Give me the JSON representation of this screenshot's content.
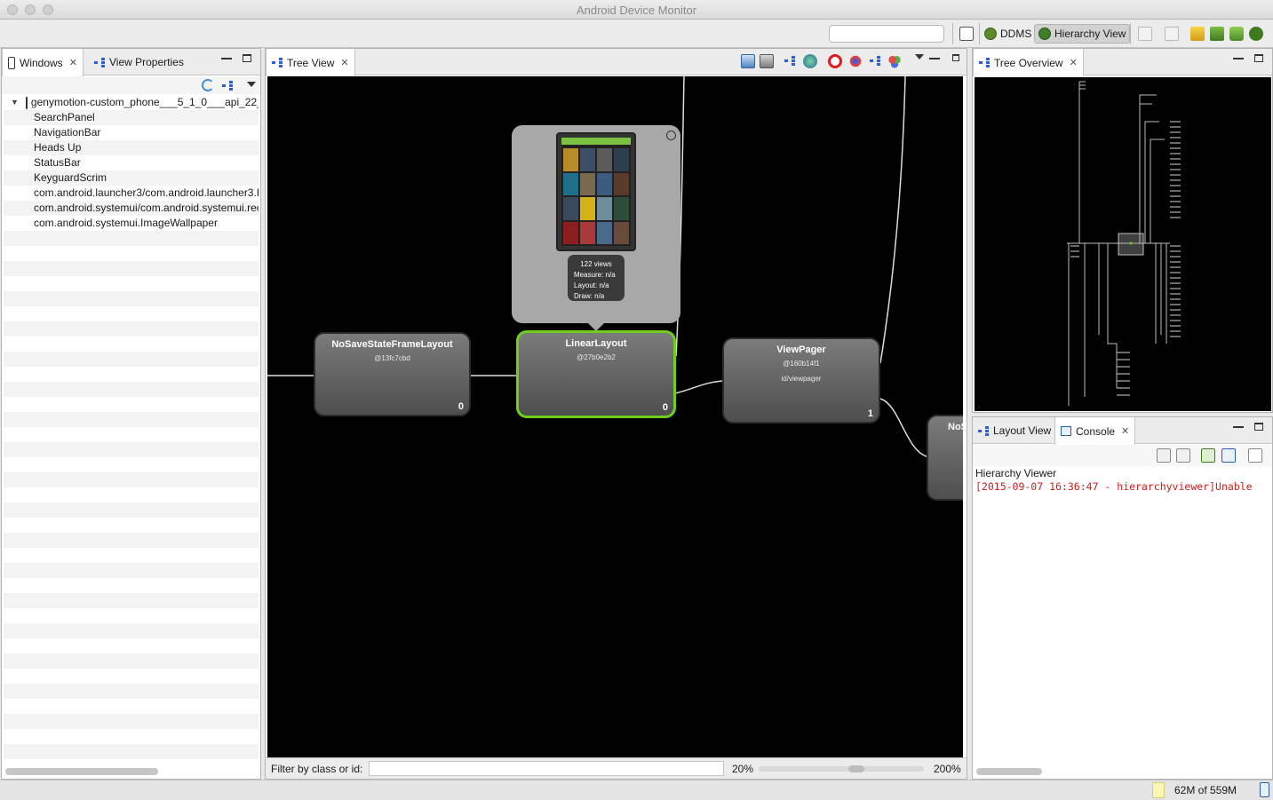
{
  "window": {
    "title": "Android Device Monitor"
  },
  "toolbar": {
    "search_placeholder": "",
    "perspectives": [
      {
        "label": "DDMS",
        "active": false
      },
      {
        "label": "Hierarchy View",
        "active": true
      }
    ]
  },
  "windows_panel": {
    "tabs": [
      {
        "label": "Windows",
        "icon": "phone-icon",
        "active": true
      },
      {
        "label": "View Properties",
        "icon": "tree-icon",
        "active": false
      }
    ],
    "device": "genymotion-custom_phone___5_1_0___api_22_",
    "items": [
      "SearchPanel",
      "NavigationBar",
      "Heads Up",
      "StatusBar",
      "KeyguardScrim",
      "com.android.launcher3/com.android.launcher3.L",
      "com.android.systemui/com.android.systemui.rec",
      "com.android.systemui.ImageWallpaper"
    ]
  },
  "tree_view": {
    "tab_label": "Tree View",
    "nodes": [
      {
        "name": "NoSaveStateFrameLayout",
        "hash": "@13fc7cbd",
        "id": "",
        "index": "0"
      },
      {
        "name": "LinearLayout",
        "hash": "@27b0e2b2",
        "id": "",
        "index": "0",
        "selected": true
      },
      {
        "name": "ViewPager",
        "hash": "@160b14f1",
        "id": "id/viewpager",
        "index": "1"
      },
      {
        "name": "NoS",
        "hash": "",
        "id": "",
        "index": ""
      }
    ],
    "preview_stats": {
      "views": "122 views",
      "measure": "Measure: n/a",
      "layout": "Layout: n/a",
      "draw": "Draw: n/a"
    },
    "filter_label": "Filter by class or id:",
    "filter_value": "",
    "zoom_min": "20%",
    "zoom_max": "200%",
    "zoom_level": 0.6
  },
  "tree_overview": {
    "tab_label": "Tree Overview"
  },
  "bottom_right": {
    "tabs": [
      {
        "label": "Layout View",
        "active": false
      },
      {
        "label": "Console",
        "active": true
      }
    ],
    "console_title": "Hierarchy Viewer",
    "console_line": "[2015-09-07 16:36:47 - hierarchyviewer]Unable"
  },
  "status": {
    "memory": "62M of 559M"
  },
  "colors": {
    "selection_green": "#6fcf1e",
    "console_error": "#d11c1c",
    "canvas_bg": "#000000"
  }
}
